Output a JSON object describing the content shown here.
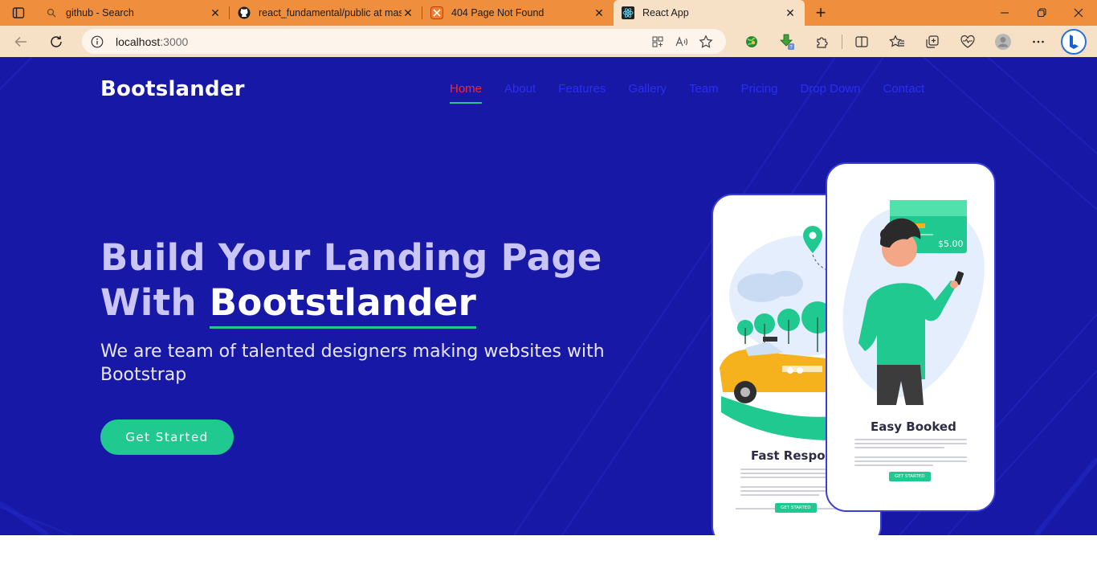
{
  "browser": {
    "tabs": [
      {
        "title": "github - Search",
        "icon": "search-icon",
        "active": false
      },
      {
        "title": "react_fundamental/public at master",
        "icon": "github-icon",
        "active": false
      },
      {
        "title": "404 Page Not Found",
        "icon": "xampp-icon",
        "active": false
      },
      {
        "title": "React App",
        "icon": "react-icon",
        "active": true
      }
    ],
    "tab_close_glyph": "✕",
    "new_tab_glyph": "+",
    "address": {
      "host": "localhost",
      "port": ":3000"
    },
    "accent": "#ef8f3d",
    "toolbar_bg": "#f6e0c6"
  },
  "site": {
    "brand": "Bootslander",
    "nav": [
      {
        "label": "Home",
        "active": true
      },
      {
        "label": "About",
        "active": false
      },
      {
        "label": "Features",
        "active": false
      },
      {
        "label": "Gallery",
        "active": false
      },
      {
        "label": "Team",
        "active": false
      },
      {
        "label": "Pricing",
        "active": false
      },
      {
        "label": "Drop Down",
        "active": false
      },
      {
        "label": "Contact",
        "active": false
      }
    ],
    "hero": {
      "title_line1": "Build Your Landing Page",
      "title_with": "With ",
      "title_strong": "Bootstlander",
      "subtitle": "We are team of talented designers making websites with Bootstrap",
      "cta": "Get Started"
    },
    "phones": {
      "back": {
        "title": "Fast Respor",
        "button": "GET STARTED"
      },
      "front": {
        "title": "Easy Booked",
        "button": "GET STARTED",
        "price": "$5.00"
      }
    },
    "colors": {
      "hero_bg": "#1719a6",
      "green": "#20c98f",
      "nav_link": "#2a2ef0",
      "nav_active": "#ff2424"
    }
  }
}
